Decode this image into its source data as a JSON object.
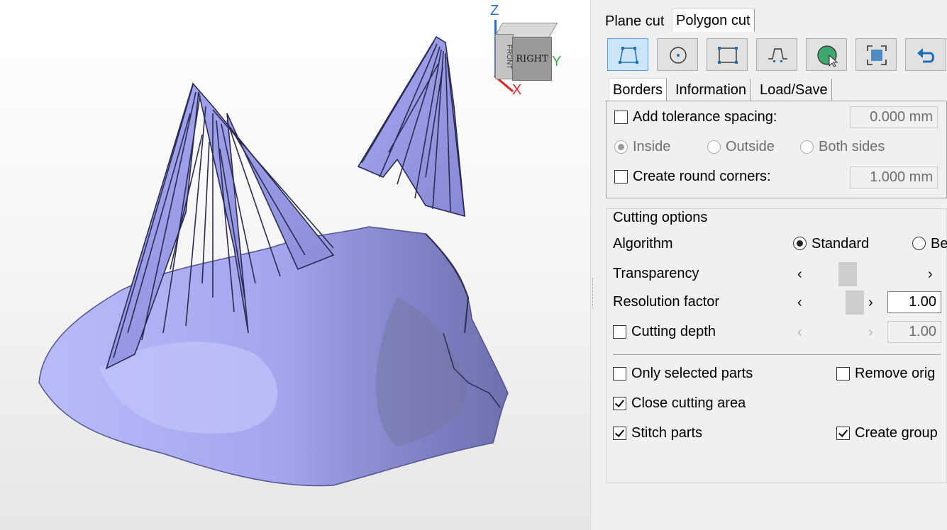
{
  "viewport": {
    "view_cube": {
      "face_label": "RIGHT",
      "side_label": "FRONT",
      "axis_z": "Z",
      "axis_x": "X",
      "axis_y": "Y",
      "colors": {
        "z": "#2a6fd8",
        "x": "#e02020",
        "y": "#3cb043"
      }
    },
    "mesh_color": "#a9aaf2"
  },
  "panel": {
    "top_tabs": [
      {
        "label": "Plane cut",
        "active": false
      },
      {
        "label": "Polygon cut",
        "active": true
      }
    ],
    "tools": [
      {
        "icon": "polygon-select-icon",
        "active": true
      },
      {
        "icon": "circle-select-icon",
        "active": false
      },
      {
        "icon": "rectangle-select-icon",
        "active": false
      },
      {
        "icon": "trapezoid-select-icon",
        "active": false
      },
      {
        "icon": "surface-pick-icon",
        "active": false
      },
      {
        "icon": "fit-view-icon",
        "active": false
      },
      {
        "icon": "undo-icon",
        "active": false
      }
    ],
    "sub_tabs": [
      {
        "label": "Borders",
        "active": true
      },
      {
        "label": "Information",
        "active": false
      },
      {
        "label": "Load/Save",
        "active": false
      }
    ],
    "borders": {
      "tolerance_label": "Add tolerance spacing:",
      "tolerance_checked": false,
      "tolerance_value": "0.000 mm",
      "side_options": [
        "Inside",
        "Outside",
        "Both sides"
      ],
      "side_selected": "Inside",
      "round_label": "Create round corners:",
      "round_checked": false,
      "round_value": "1.000 mm"
    },
    "cutting_options": {
      "title": "Cutting options",
      "algorithm_label": "Algorithm",
      "algorithm_options": [
        "Standard",
        "Be"
      ],
      "algorithm_selected": "Standard",
      "transparency_label": "Transparency",
      "resolution_label": "Resolution factor",
      "resolution_value": "1.00",
      "depth_label": "Cutting depth",
      "depth_checked": false,
      "depth_value": "1.00",
      "checkboxes": [
        {
          "label": "Only selected parts",
          "checked": false
        },
        {
          "label": "Remove orig",
          "checked": false
        },
        {
          "label": "Close cutting area",
          "checked": true
        },
        {
          "label": "Stitch parts",
          "checked": true
        },
        {
          "label": "Create group",
          "checked": true
        }
      ]
    }
  }
}
